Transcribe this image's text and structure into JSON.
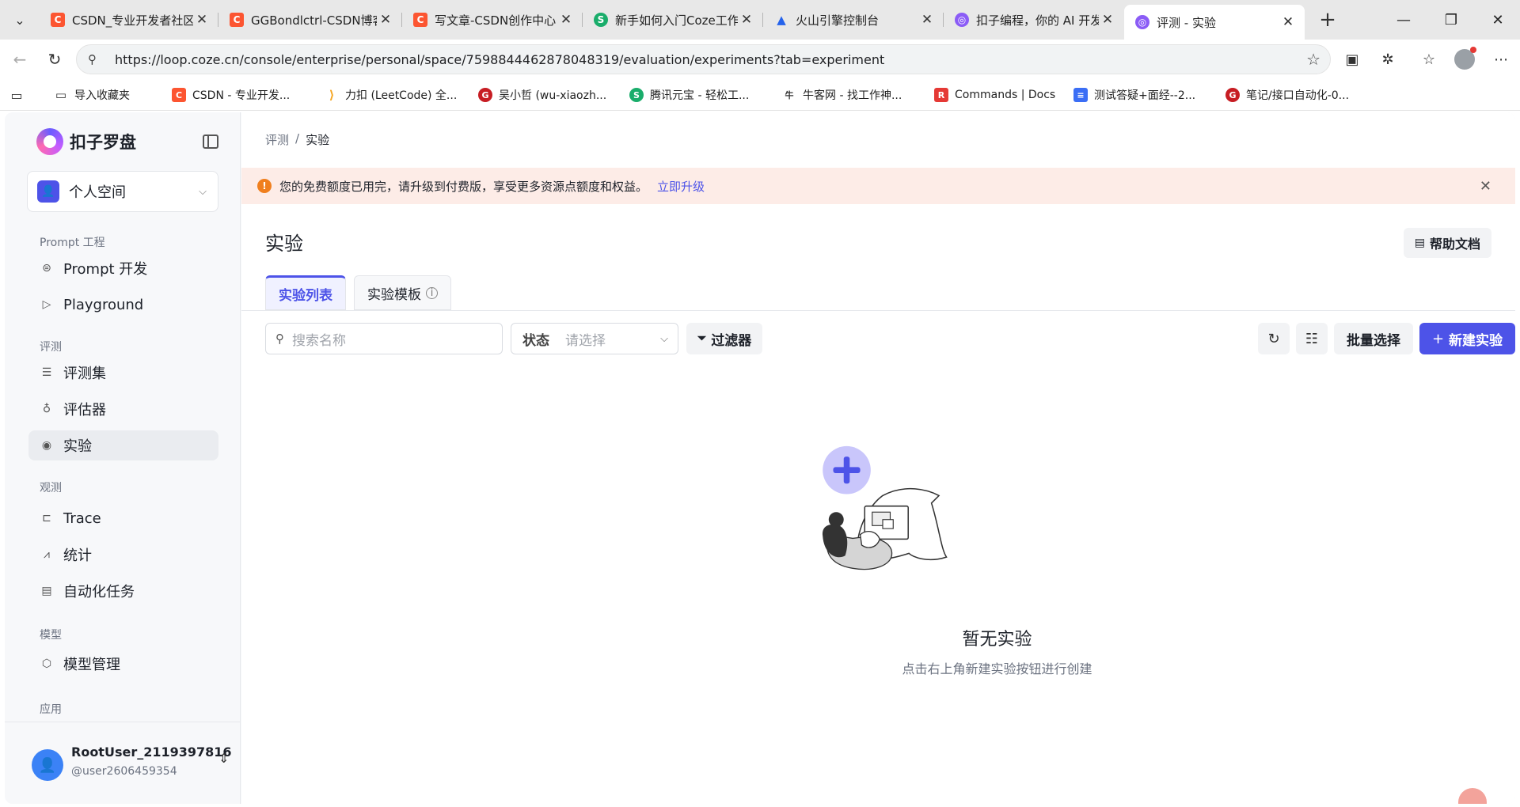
{
  "browser": {
    "tabs": [
      {
        "title": "CSDN_专业开发者社区_",
        "fav": "C",
        "favColor": "#fc5531"
      },
      {
        "title": "GGBondlctrl-CSDN博客",
        "fav": "C",
        "favColor": "#fc5531"
      },
      {
        "title": "写文章-CSDN创作中心",
        "fav": "C",
        "favColor": "#fc5531"
      },
      {
        "title": "新手如何入门Coze工作",
        "fav": "S",
        "favColor": "#1aad6b"
      },
      {
        "title": "火山引擎控制台",
        "fav": "▲",
        "favColor": "#2563eb"
      },
      {
        "title": "扣子编程，你的 AI 开发",
        "fav": "◎",
        "favColor": "#8b5cf6"
      },
      {
        "title": "评测 - 实验",
        "fav": "◎",
        "favColor": "#8b5cf6"
      }
    ],
    "url": "https://loop.coze.cn/console/enterprise/personal/space/7598844462878048319/evaluation/experiments?tab=experiment",
    "bookmarks": [
      {
        "label": "导入收藏夹",
        "fav": "▭",
        "favColor": "#555"
      },
      {
        "label": "CSDN - 专业开发...",
        "fav": "C",
        "favColor": "#fc5531"
      },
      {
        "label": "力扣 (LeetCode) 全...",
        "fav": "⟩",
        "favColor": "#f5a623"
      },
      {
        "label": "吴小哲 (wu-xiaozh...",
        "fav": "G",
        "favColor": "#c71d23"
      },
      {
        "label": "腾讯元宝 - 轻松工...",
        "fav": "S",
        "favColor": "#1aad6b"
      },
      {
        "label": "牛客网 - 找工作神...",
        "fav": "牛",
        "favColor": "#333"
      },
      {
        "label": "Commands | Docs",
        "fav": "R",
        "favColor": "#e53935"
      },
      {
        "label": "测试答疑+面经--2...",
        "fav": "≡",
        "favColor": "#3b6ef5"
      },
      {
        "label": "笔记/接口自动化-0...",
        "fav": "G",
        "favColor": "#c71d23"
      }
    ]
  },
  "sidebar": {
    "brand": "扣子罗盘",
    "space": "个人空间",
    "groups": {
      "prompt": "Prompt 工程",
      "eval": "评测",
      "observe": "观测",
      "model": "模型",
      "app": "应用"
    },
    "items": {
      "prompt_dev": "Prompt 开发",
      "playground": "Playground",
      "datasets": "评测集",
      "evaluators": "评估器",
      "experiments": "实验",
      "trace": "Trace",
      "stats": "统计",
      "auto_tasks": "自动化任务",
      "model_mgmt": "模型管理"
    },
    "user": {
      "name": "RootUser_2119397816",
      "handle": "@user2606459354"
    }
  },
  "main": {
    "breadcrumb": {
      "parent": "评测",
      "sep": "/",
      "current": "实验"
    },
    "alert": {
      "text": "您的免费额度已用完，请升级到付费版，享受更多资源点额度和权益。",
      "link": "立即升级"
    },
    "title": "实验",
    "help": "帮助文档",
    "tabs": {
      "list": "实验列表",
      "template": "实验模板"
    },
    "toolbar": {
      "search_placeholder": "搜索名称",
      "status_label": "状态",
      "status_placeholder": "请选择",
      "filter": "过滤器",
      "batch": "批量选择",
      "new": "新建实验"
    },
    "empty": {
      "title": "暂无实验",
      "subtitle": "点击右上角新建实验按钮进行创建"
    }
  },
  "colors": {
    "accent": "#4d53e8",
    "alert_bg": "#fdece7",
    "warn": "#f07f1e"
  }
}
